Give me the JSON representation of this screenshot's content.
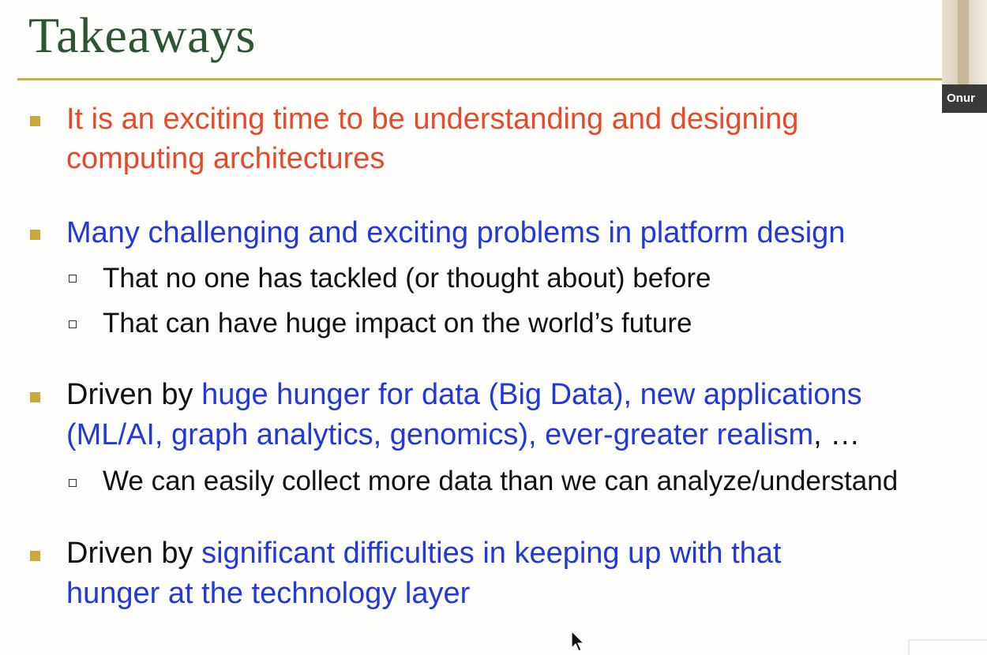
{
  "slide": {
    "title": "Takeaways",
    "bullets": [
      {
        "lines": [
          [
            {
              "text": "It is an exciting time to be understanding and designing",
              "color": "red"
            }
          ],
          [
            {
              "text": "computing architectures",
              "color": "red"
            }
          ]
        ]
      },
      {
        "lines": [
          [
            {
              "text": "Many challenging and exciting problems in platform design",
              "color": "blue"
            }
          ]
        ],
        "sub": [
          "That no one has tackled (or thought about) before",
          "That can have huge impact on the world’s future"
        ]
      },
      {
        "lines": [
          [
            {
              "text": "Driven by ",
              "color": "black"
            },
            {
              "text": "huge hunger for data (Big Data), new applications",
              "color": "blue"
            }
          ],
          [
            {
              "text": "(ML/AI, graph analytics, genomics), ever-greater realism",
              "color": "blue"
            },
            {
              "text": ", …",
              "color": "black"
            }
          ]
        ],
        "sub": [
          "We can easily collect more data than we can analyze/understand"
        ]
      },
      {
        "lines": [
          [
            {
              "text": "Driven by ",
              "color": "black"
            },
            {
              "text": "significant difficulties in keeping up with that",
              "color": "blue"
            }
          ],
          [
            {
              "text": "hunger at the technology layer",
              "color": "blue"
            }
          ]
        ]
      }
    ]
  },
  "video_tile": {
    "name_label": "Onur"
  },
  "colors": {
    "title": "#2e5533",
    "rule": "#c9b04a",
    "bullet": "#c9a93e",
    "red": "#e64a2a",
    "blue": "#2338d8",
    "black": "#111111"
  },
  "icons": {
    "bullet": "square-bullet-icon",
    "sub_bullet": "hollow-square-bullet-icon",
    "cursor": "mouse-pointer-icon"
  }
}
